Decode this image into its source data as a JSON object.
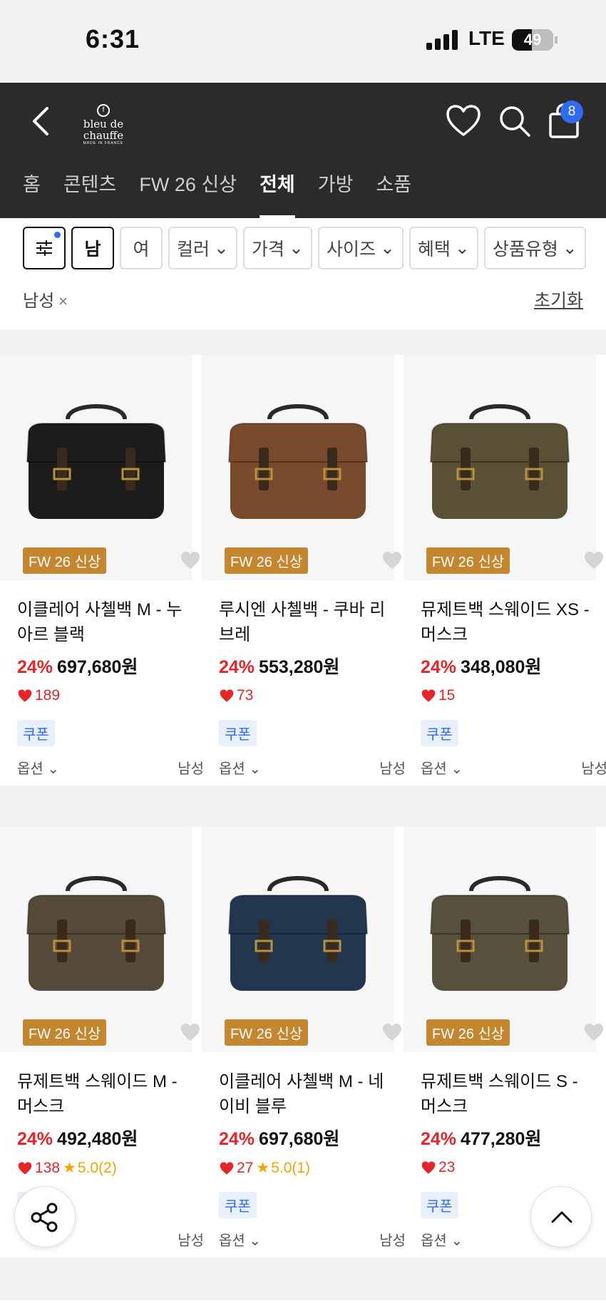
{
  "status_bar": {
    "time": "6:31",
    "network": "LTE",
    "battery": "49",
    "battery_level": 0.49
  },
  "header": {
    "brand": "bleu de chauffe",
    "brand_sub": "MADE IN FRANCE",
    "cart_count": "8",
    "tabs": [
      {
        "label": "홈"
      },
      {
        "label": "콘텐츠"
      },
      {
        "label": "FW 26 신상"
      },
      {
        "label": "전체",
        "active": true
      },
      {
        "label": "가방"
      },
      {
        "label": "소품"
      }
    ]
  },
  "filters": {
    "chips": [
      "남",
      "여",
      "컬러",
      "가격",
      "사이즈",
      "혜택",
      "상품유형"
    ],
    "selected": "남성",
    "reset_label": "초기화"
  },
  "products": [
    {
      "tag": "FW 26 신상",
      "name": "이클레어 사첼백 M - 누아르 블랙",
      "discount": "24%",
      "price": "697,680원",
      "likes": "189",
      "rating": "",
      "coupon": "쿠폰",
      "option": "옵션",
      "gender": "남성",
      "bag_color": "#1c1c1c"
    },
    {
      "tag": "FW 26 신상",
      "name": "루시엔 사첼백 - 쿠바 리브레",
      "discount": "24%",
      "price": "553,280원",
      "likes": "73",
      "rating": "",
      "coupon": "쿠폰",
      "option": "옵션",
      "gender": "남성",
      "bag_color": "#7a4a2c"
    },
    {
      "tag": "FW 26 신상",
      "name": "뮤제트백 스웨이드 XS - 머스크",
      "discount": "24%",
      "price": "348,080원",
      "likes": "15",
      "rating": "",
      "coupon": "쿠폰",
      "option": "옵션",
      "gender": "남성",
      "bag_color": "#5a5036"
    },
    {
      "tag": "FW 26 신상",
      "name": "뮤제트백 스웨이드 M - 머스크",
      "discount": "24%",
      "price": "492,480원",
      "likes": "138",
      "rating": "5.0(2)",
      "coupon": "쿠폰",
      "option": "",
      "gender": "남성",
      "bag_color": "#55493a"
    },
    {
      "tag": "FW 26 신상",
      "name": "이클레어 사첼백 M - 네이비 블루",
      "discount": "24%",
      "price": "697,680원",
      "likes": "27",
      "rating": "5.0(1)",
      "coupon": "쿠폰",
      "option": "옵션",
      "gender": "남성",
      "bag_color": "#233650"
    },
    {
      "tag": "FW 26 신상",
      "name": "뮤제트백 스웨이드 S - 머스크",
      "discount": "24%",
      "price": "477,280원",
      "likes": "23",
      "rating": "",
      "coupon": "쿠폰",
      "option": "옵션",
      "gender": "",
      "bag_color": "#57503c"
    }
  ],
  "icons": {
    "back": "chevron-left-icon",
    "wishlist": "heart-icon",
    "search": "search-icon",
    "cart": "shopping-bag-icon",
    "filter": "sliders-icon",
    "share": "share-icon",
    "scroll_top": "chevron-up-icon"
  },
  "colors": {
    "header_bg": "#2b2b2b",
    "accent_red": "#e52528",
    "tag_orange": "#c4862e",
    "coupon_blue": "#2f6bf5"
  }
}
